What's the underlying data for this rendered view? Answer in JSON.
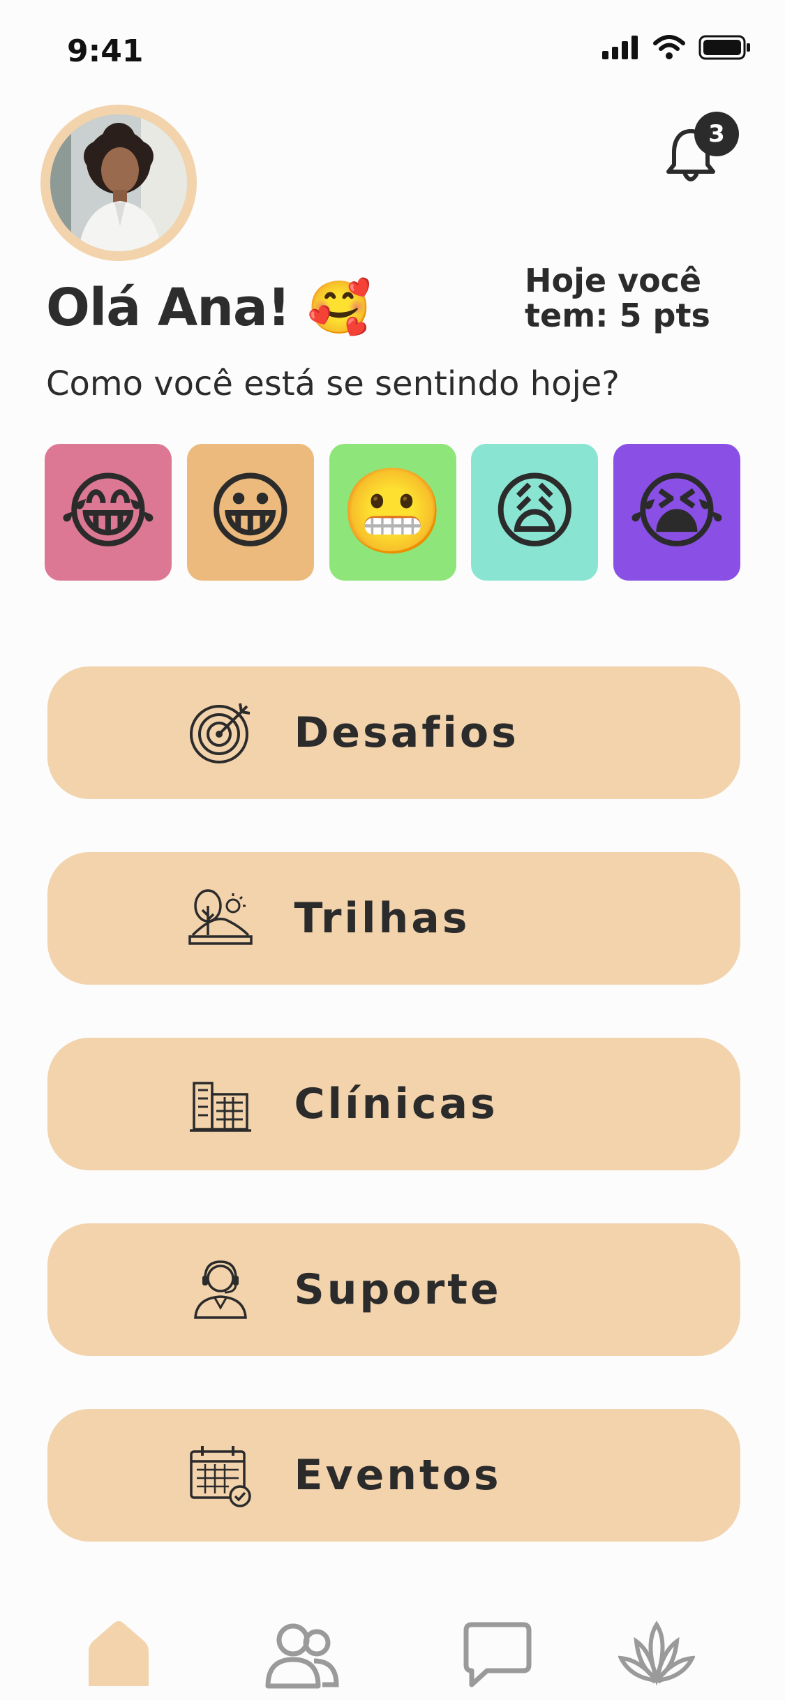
{
  "status": {
    "time": "9:41"
  },
  "user": {
    "greeting": "Olá Ana! 🥰",
    "notifications": "3"
  },
  "points": {
    "text": "Hoje você tem: 5 pts"
  },
  "prompt": "Como você está se sentindo hoje?",
  "moods": [
    {
      "emoji": "😂",
      "color": "#dc7894"
    },
    {
      "emoji": "😀",
      "color": "#ebba7c"
    },
    {
      "emoji": "😬",
      "color": "#8ee67a"
    },
    {
      "emoji": "😩",
      "color": "#8ae4d2"
    },
    {
      "emoji": "😭",
      "color": "#8a50e6"
    }
  ],
  "menu": [
    {
      "label": "Desafios",
      "icon": "target-icon"
    },
    {
      "label": "Trilhas",
      "icon": "landscape-icon"
    },
    {
      "label": "Clínicas",
      "icon": "building-icon"
    },
    {
      "label": "Suporte",
      "icon": "headset-agent-icon"
    },
    {
      "label": "Eventos",
      "icon": "calendar-check-icon"
    }
  ],
  "nav": [
    {
      "icon": "home-icon",
      "active": true
    },
    {
      "icon": "users-icon",
      "active": false
    },
    {
      "icon": "chat-icon",
      "active": false
    },
    {
      "icon": "lotus-icon",
      "active": false
    }
  ],
  "colors": {
    "accent": "#f2d3ac",
    "text": "#2b2b2b",
    "nav_inactive": "#9a9a9a"
  }
}
